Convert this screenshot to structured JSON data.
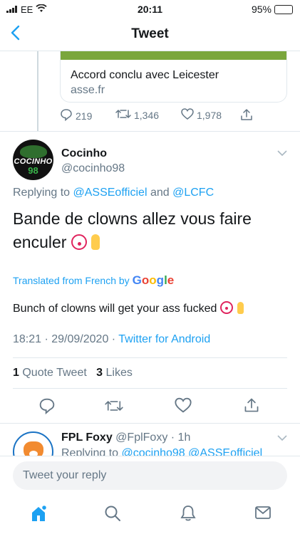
{
  "status_bar": {
    "carrier": "EE",
    "time": "20:11",
    "battery": "95%"
  },
  "header": {
    "title": "Tweet"
  },
  "quoted_card": {
    "title": "Accord conclu avec Leicester",
    "domain": "asse.fr"
  },
  "parent_actions": {
    "replies": "219",
    "retweets": "1,346",
    "likes": "1,978"
  },
  "tweet": {
    "display_name": "Cocinho",
    "handle": "@cocinho98",
    "avatar_text": "COCINHO",
    "avatar_number": "98",
    "replying_prefix": "Replying to",
    "replying_user1": "@ASSEofficiel",
    "replying_and": "and",
    "replying_user2": "@LCFC",
    "text": "Bande de clowns allez vous faire enculer",
    "translated_label": "Translated from French by",
    "translated_by": "Google",
    "translation": "Bunch of clowns will get your ass fucked",
    "time": "18:21 · 29/09/2020 ·",
    "client": "Twitter for Android",
    "quote_count": "1",
    "quote_label": "Quote Tweet",
    "like_count": "3",
    "like_label": "Likes"
  },
  "reply": {
    "display_name": "FPL Foxy",
    "handle": "@FplFoxy",
    "time": "· 1h",
    "replying_prefix": "Replying to",
    "replying_users": "@cocinho98 @ASSEofficiel"
  },
  "composer": {
    "placeholder": "Tweet your reply"
  },
  "colors": {
    "accent": "#1da1f2",
    "text": "#14171a",
    "muted": "#657786"
  },
  "icons": [
    "back-chevron-icon",
    "reply-icon",
    "retweet-icon",
    "like-icon",
    "share-icon",
    "chevron-down-icon",
    "home-icon",
    "search-icon",
    "notifications-icon",
    "messages-icon"
  ]
}
